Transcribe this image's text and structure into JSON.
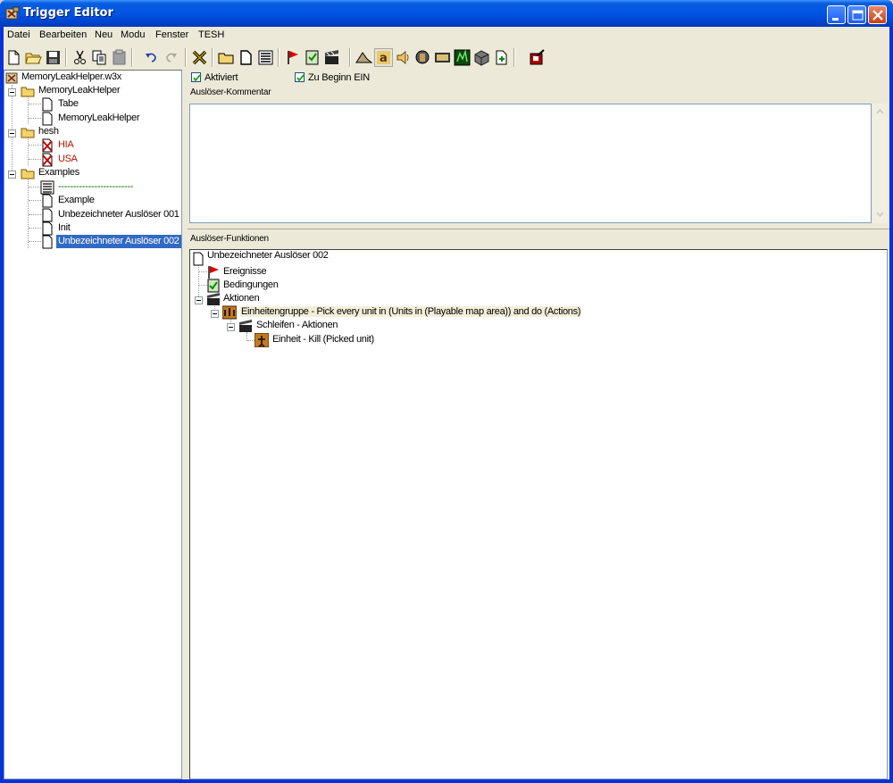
{
  "window": {
    "title": "Trigger Editor"
  },
  "menu": [
    "Datei",
    "Bearbeiten",
    "Neu",
    "Modu",
    "Fenster",
    "TESH"
  ],
  "toolbar_icons": [
    "new-icon",
    "open-icon",
    "save-icon",
    "cut-icon",
    "copy-icon",
    "paste-icon",
    "undo-icon",
    "redo-icon",
    "delete-icon",
    "new-category-icon",
    "new-trigger-icon",
    "new-comment-icon",
    "new-event-icon",
    "new-condition-icon",
    "new-action-icon",
    "terrain-editor-icon",
    "trigger-editor-icon",
    "sound-editor-icon",
    "object-editor-icon",
    "campaign-editor-icon",
    "ai-editor-icon",
    "object-manager-icon",
    "import-manager-icon",
    "test-map-icon"
  ],
  "tree": {
    "root": "MemoryLeakHelper.w3x",
    "items": [
      {
        "label": "MemoryLeakHelper"
      },
      {
        "label": "Tabe"
      },
      {
        "label": "MemoryLeakHelper"
      },
      {
        "label": "hesh"
      },
      {
        "label": "HIA"
      },
      {
        "label": "USA"
      },
      {
        "label": "Examples"
      },
      {
        "label": "-------------------------"
      },
      {
        "label": "Example"
      },
      {
        "label": "Unbezeichneter Auslöser 001"
      },
      {
        "label": "Init"
      },
      {
        "label": "Unbezeichneter Auslöser 002"
      }
    ]
  },
  "trigger": {
    "enabled_label": "Aktiviert",
    "initially_on_label": "Zu Beginn EIN",
    "comment_label": "Auslöser-Kommentar",
    "functions_label": "Auslöser-Funktionen",
    "functions": {
      "name": "Unbezeichneter Auslöser 002",
      "events": "Ereignisse",
      "conditions": "Bedingungen",
      "actions": "Aktionen",
      "action1": "Einheitengruppe - Pick every unit in (Units in (Playable map area)) and do (Actions)",
      "loop_actions": "Schleifen - Aktionen",
      "action2": "Einheit - Kill (Picked unit)"
    }
  }
}
